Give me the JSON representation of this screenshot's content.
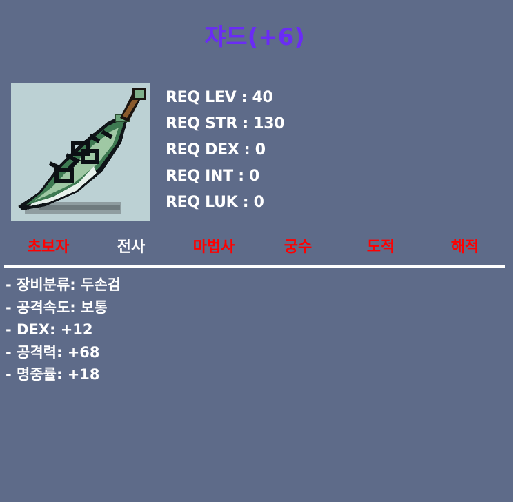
{
  "item": {
    "name": "쟈드(+6)"
  },
  "icon": {
    "name": "greatsword-icon"
  },
  "requirements": [
    {
      "label": "REQ LEV : 40"
    },
    {
      "label": "REQ STR : 130"
    },
    {
      "label": "REQ DEX : 0"
    },
    {
      "label": "REQ INT : 0"
    },
    {
      "label": "REQ LUK : 0"
    }
  ],
  "jobs": [
    {
      "label": "초보자",
      "color": "#ff0000",
      "available": false
    },
    {
      "label": "전사",
      "color": "#ffffff",
      "available": true
    },
    {
      "label": "마법사",
      "color": "#ff0000",
      "available": false
    },
    {
      "label": "궁수",
      "color": "#ff0000",
      "available": false
    },
    {
      "label": "도적",
      "color": "#ff0000",
      "available": false
    },
    {
      "label": "해적",
      "color": "#ff0000",
      "available": false
    }
  ],
  "stats": [
    {
      "text": "- 장비분류: 두손검"
    },
    {
      "text": "- 공격속도: 보통"
    },
    {
      "text": "- DEX: +12"
    },
    {
      "text": "- 공격력: +68"
    },
    {
      "text": "- 명중률: +18"
    }
  ],
  "colors": {
    "background": "#5e6b89",
    "title": "#6a2cf5",
    "unavailable_job": "#ff0000",
    "available_job": "#ffffff",
    "icon_background": "#bcd1d4"
  }
}
